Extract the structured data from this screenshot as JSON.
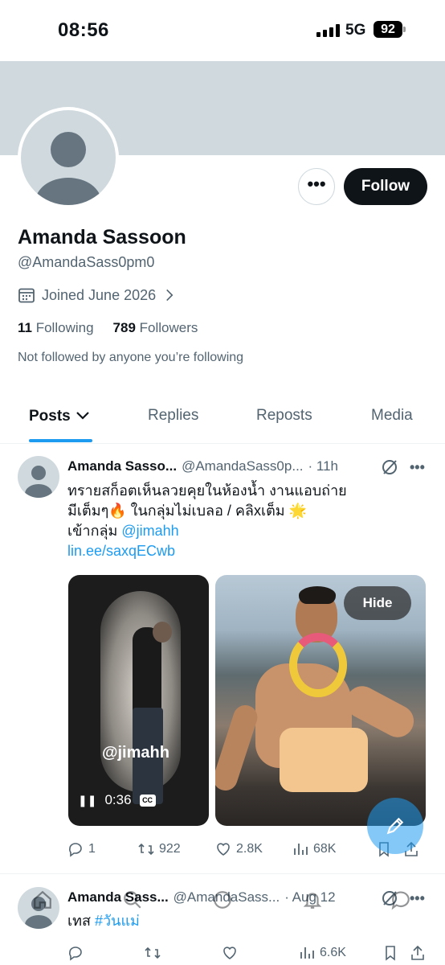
{
  "status_bar": {
    "time": "08:56",
    "network": "5G",
    "battery": "92"
  },
  "profile": {
    "display_name": "Amanda Sassoon",
    "handle": "@AmandaSass0pm0",
    "joined": "Joined June 2026",
    "following_count": "11",
    "following_label": "Following",
    "followers_count": "789",
    "followers_label": "Followers",
    "not_followed_text": "Not followed by anyone you’re following",
    "follow_label": "Follow",
    "more_label": "•••"
  },
  "tabs": [
    {
      "label": "Posts"
    },
    {
      "label": "Replies"
    },
    {
      "label": "Reposts"
    },
    {
      "label": "Media"
    }
  ],
  "posts": [
    {
      "name": "Amanda Sasso...",
      "handle": "@AmandaSass0p...",
      "time": "· 11h",
      "text_line1": "ทรายสก็อตเห็นลวยคุยในห้องน้ำ งานแอบถ่าย",
      "text_line2": "มีเต็มๆ🔥 ในกลุ่มไม่เบลอ / คลิxเต็ม 🌟",
      "text_line3_prefix": " เข้ากลุ่ม ",
      "mention": "@jimahh",
      "link": "lin.ee/saxqECwb",
      "video_watermark": "@jimahh",
      "video_time": "0:36",
      "cc_label": "CC",
      "hide_label": "Hide",
      "replies": "1",
      "reposts": "922",
      "likes": "2.8K",
      "views": "68K"
    },
    {
      "name": "Amanda Sass...",
      "handle": "@AmandaSass...",
      "time": "· Aug 12",
      "text_prefix": "เทส ",
      "hashtag": "#วันแม่",
      "views": "6.6K"
    }
  ],
  "colors": {
    "accent": "#1d9bf0",
    "text": "#0f1419",
    "muted": "#536471",
    "banner": "#cfd9de"
  },
  "icons": [
    "calendar-icon",
    "chevron-right-icon",
    "chevron-down-icon",
    "more-icon",
    "grok-icon",
    "reply-icon",
    "repost-icon",
    "like-icon",
    "views-icon",
    "bookmark-icon",
    "share-icon",
    "compose-icon",
    "home-icon",
    "search-icon",
    "notifications-icon",
    "messages-icon"
  ]
}
